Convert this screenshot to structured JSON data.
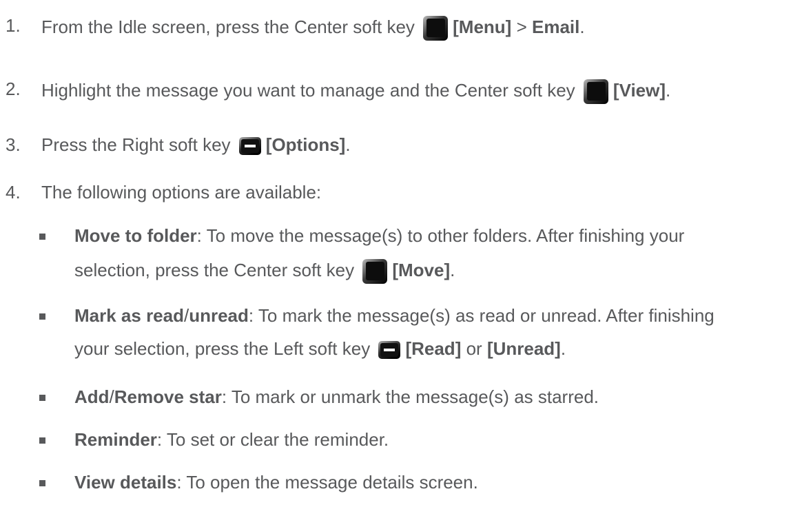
{
  "steps": [
    {
      "number": "1.",
      "parts": {
        "a": "From the Idle screen, press the Center soft key",
        "b": "[Menu]",
        "c": " > ",
        "d": "Email",
        "e": "."
      }
    },
    {
      "number": "2.",
      "parts": {
        "a": "Highlight the message you want to manage and the Center soft key",
        "b": "[View]",
        "c": "."
      }
    },
    {
      "number": "3.",
      "parts": {
        "a": "Press the Right soft key",
        "b": "[Options]",
        "c": "."
      }
    },
    {
      "number": "4.",
      "parts": {
        "a": "The following options are available:"
      }
    }
  ],
  "options": {
    "move": {
      "title": "Move to folder",
      "line1": ": To move the message(s) to other folders. After finishing your",
      "line2a": "selection, press the Center soft key",
      "line2b": "[Move]",
      "line2c": "."
    },
    "mark": {
      "title_a": "Mark as read",
      "slash": "/",
      "title_b": "unread",
      "line1": ": To mark the message(s) as read or unread. After finishing",
      "line2a": "your selection, press the Left soft key",
      "line2b": "[Read]",
      "line2c": " or ",
      "line2d": "[Unread]",
      "line2e": "."
    },
    "star": {
      "title_a": "Add",
      "slash": "/",
      "title_b": "Remove star",
      "desc": ": To mark or unmark the message(s) as starred."
    },
    "reminder": {
      "title": "Reminder",
      "desc": ": To set or clear the reminder."
    },
    "details": {
      "title": "View details",
      "desc": ": To open the message details screen."
    }
  },
  "icons": {
    "center_key": "center-soft-key-icon",
    "side_key": "side-soft-key-icon"
  },
  "colors": {
    "text": "#58595b",
    "key_dark": "#111111",
    "key_highlight": "#9a9a9a"
  }
}
